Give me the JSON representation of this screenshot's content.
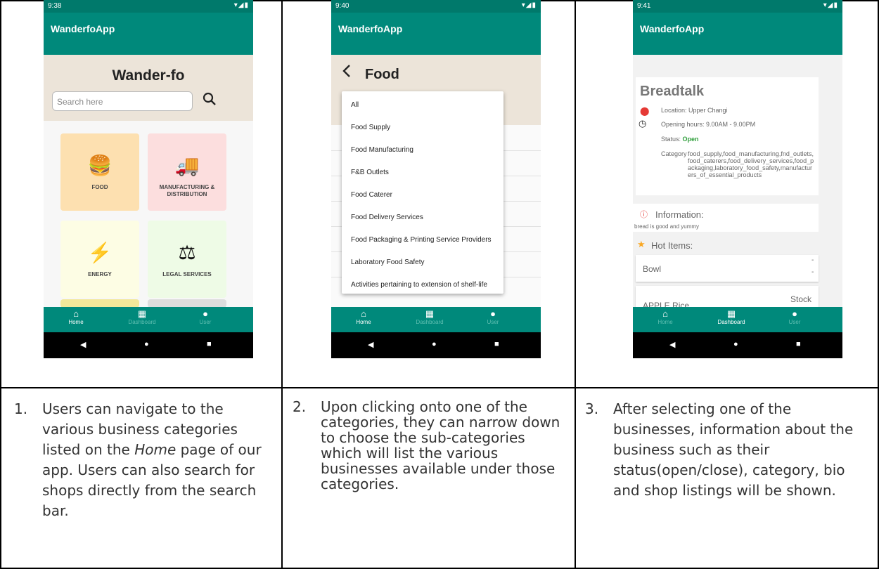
{
  "phones": {
    "p1": {
      "status_time": "9:38",
      "app_title": "WanderfoApp",
      "heading": "Wander-fo",
      "search_placeholder": "Search here",
      "tiles": [
        "FOOD",
        "MANUFACTURING & DISTRIBUTION",
        "ENERGY",
        "LEGAL SERVICES"
      ]
    },
    "p2": {
      "status_time": "9:40",
      "app_title": "WanderfoApp",
      "heading": "Food",
      "dropdown": [
        "All",
        "Food Supply",
        "Food Manufacturing",
        "F&B Outlets",
        "Food Caterer",
        "Food Delivery Services",
        "Food Packaging & Printing Service Providers",
        "Laboratory Food Safety",
        "Activities pertaining to extension of shelf-life"
      ]
    },
    "p3": {
      "status_time": "9:41",
      "app_title": "WanderfoApp",
      "name": "Breadtalk",
      "location": "Location:  Upper Changi",
      "hours": "Opening hours:  9.00AM - 9.00PM",
      "status_label": "Status:",
      "status_value": "Open",
      "category_label": "Category",
      "category_value": "food_supply,food_manufacturing,fnd_outlets,food_caterers,food_delivery_services,food_packaging,laboratory_food_safety,manufacturers_of_essential_products",
      "info_title": "Information:",
      "info_text": "bread is good and yummy",
      "hot_title": "Hot Items:",
      "item1": "Bowl",
      "item1_dash1": "-",
      "item1_dash2": "-",
      "item2": "APPLE Rice",
      "item2_stock": "Stock"
    }
  },
  "nav": {
    "home": "Home",
    "dashboard": "Dashboard",
    "user": "User"
  },
  "captions": [
    {
      "num": "1.",
      "pre": "Users can navigate to the various business categories listed on the ",
      "em": "Home",
      "post": " page of our app. Users can also search for shops directly from the search bar."
    },
    {
      "num": "2.",
      "text": "Upon clicking onto one of the categories, they can narrow down to choose the sub-categories which will list the various businesses available under those categories."
    },
    {
      "num": "3.",
      "text": "After selecting one of the businesses, information about the business such as their status(open/close), category, bio and shop listings will be shown."
    }
  ]
}
